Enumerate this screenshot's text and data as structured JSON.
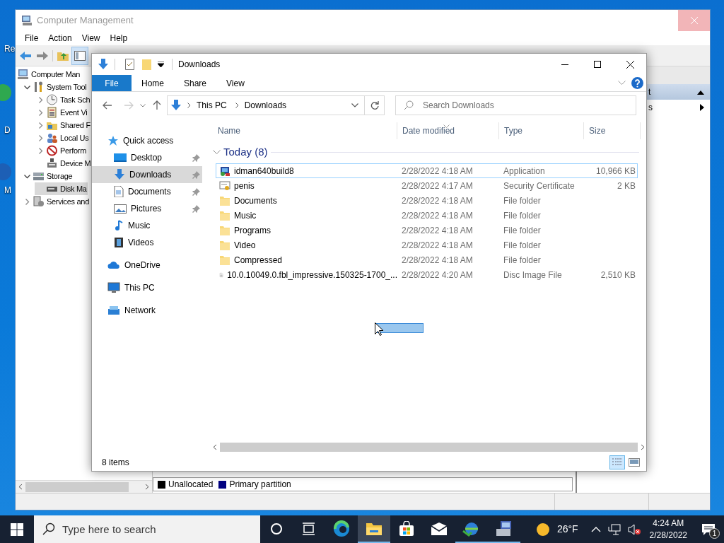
{
  "desktop_icons": [
    {
      "label": "Re"
    },
    {
      "label": "D"
    },
    {
      "label": "M"
    }
  ],
  "computer_management": {
    "title": "Computer Management",
    "menu": [
      "File",
      "Action",
      "View",
      "Help"
    ],
    "tree": [
      {
        "label": "Computer Man",
        "kind": "computer",
        "selected": false,
        "children": [
          {
            "label": "System Tool",
            "kind": "tools",
            "expanded": true,
            "selected": false,
            "children": [
              {
                "label": "Task Sch",
                "kind": "clock",
                "expanded": false,
                "selected": false
              },
              {
                "label": "Event Vi",
                "kind": "log",
                "expanded": false,
                "selected": false
              },
              {
                "label": "Shared F",
                "kind": "shared",
                "expanded": false,
                "selected": false
              },
              {
                "label": "Local Us",
                "kind": "users",
                "expanded": false,
                "selected": false
              },
              {
                "label": "Perform",
                "kind": "perf",
                "expanded": false,
                "selected": false
              },
              {
                "label": "Device M",
                "kind": "device",
                "selected": false
              }
            ]
          },
          {
            "label": "Storage",
            "kind": "storage",
            "expanded": true,
            "selected": false,
            "children": [
              {
                "label": "Disk Ma",
                "kind": "disk",
                "selected": true
              }
            ]
          },
          {
            "label": "Services and",
            "kind": "services",
            "expanded": false,
            "selected": false
          }
        ]
      }
    ],
    "legend": [
      {
        "label": "Unallocated",
        "color": "#000000"
      },
      {
        "label": "Primary partition",
        "color": "#000080"
      }
    ],
    "actions": [
      {
        "label": "t",
        "kind": "header"
      },
      {
        "label": "s",
        "kind": "item"
      }
    ]
  },
  "explorer": {
    "title": "Downloads",
    "ribbon_tabs": [
      {
        "label": "File",
        "kind": "file"
      },
      {
        "label": "Home",
        "kind": "tab"
      },
      {
        "label": "Share",
        "kind": "tab"
      },
      {
        "label": "View",
        "kind": "tab"
      }
    ],
    "path": [
      "This PC",
      "Downloads"
    ],
    "search": {
      "placeholder": "Search Downloads"
    },
    "nav": [
      {
        "label": "Quick access",
        "kind": "star",
        "selected": false,
        "children": [
          {
            "label": "Desktop",
            "kind": "desktop",
            "pinned": true,
            "selected": false
          },
          {
            "label": "Downloads",
            "kind": "downloads",
            "pinned": true,
            "selected": true
          },
          {
            "label": "Documents",
            "kind": "documents",
            "pinned": true,
            "selected": false
          },
          {
            "label": "Pictures",
            "kind": "pictures",
            "pinned": true,
            "selected": false
          },
          {
            "label": "Music",
            "kind": "music",
            "pinned": false,
            "selected": false
          },
          {
            "label": "Videos",
            "kind": "videos",
            "pinned": false,
            "selected": false
          }
        ]
      },
      {
        "label": "OneDrive",
        "kind": "cloud",
        "selected": false
      },
      {
        "label": "This PC",
        "kind": "pc",
        "selected": false
      },
      {
        "label": "Network",
        "kind": "network",
        "selected": false
      }
    ],
    "columns": [
      {
        "label": "Name",
        "sorted": false
      },
      {
        "label": "Date modified",
        "sorted": true
      },
      {
        "label": "Type",
        "sorted": false
      },
      {
        "label": "Size",
        "sorted": false
      }
    ],
    "groups": [
      {
        "label": "Today (8)",
        "expanded": true,
        "files": [
          {
            "name": "idman640build8",
            "date": "2/28/2022 4:18 AM",
            "type": "Application",
            "size": "10,966 KB",
            "kind": "app",
            "focused": true
          },
          {
            "name": "penis",
            "date": "2/28/2022 4:17 AM",
            "type": "Security Certificate",
            "size": "2 KB",
            "kind": "certificate",
            "focused": false
          },
          {
            "name": "Documents",
            "date": "2/28/2022 4:18 AM",
            "type": "File folder",
            "kind": "folder",
            "focused": false
          },
          {
            "name": "Music",
            "date": "2/28/2022 4:18 AM",
            "type": "File folder",
            "kind": "folder",
            "focused": false
          },
          {
            "name": "Programs",
            "date": "2/28/2022 4:18 AM",
            "type": "File folder",
            "kind": "folder",
            "focused": false
          },
          {
            "name": "Video",
            "date": "2/28/2022 4:18 AM",
            "type": "File folder",
            "kind": "folder",
            "focused": false
          },
          {
            "name": "Compressed",
            "date": "2/28/2022 4:18 AM",
            "type": "File folder",
            "kind": "folder",
            "focused": false
          },
          {
            "name": "10.0.10049.0.fbl_impressive.150325-1700_...",
            "date": "2/28/2022 4:20 AM",
            "type": "Disc Image File",
            "size": "2,510 KB",
            "kind": "disc",
            "focused": false
          }
        ]
      }
    ],
    "status": "8 items",
    "views": [
      {
        "kind": "details",
        "selected": true
      },
      {
        "kind": "large-icons",
        "selected": false
      }
    ]
  },
  "taskbar": {
    "search": {
      "placeholder": "Type here to search"
    },
    "apps": [
      {
        "kind": "cortana",
        "active": false,
        "running": false
      },
      {
        "kind": "taskview",
        "active": false,
        "running": false
      },
      {
        "kind": "edge",
        "active": false,
        "running": false
      },
      {
        "kind": "explorer",
        "active": true,
        "running": true
      },
      {
        "kind": "store",
        "active": false,
        "running": false
      },
      {
        "kind": "mail",
        "active": false,
        "running": false
      },
      {
        "kind": "idm",
        "active": false,
        "running": true
      },
      {
        "kind": "remote",
        "active": false,
        "running": true
      }
    ],
    "weather": "26°F",
    "time": "4:24 AM",
    "date": "2/28/2022",
    "notifications": "1"
  }
}
